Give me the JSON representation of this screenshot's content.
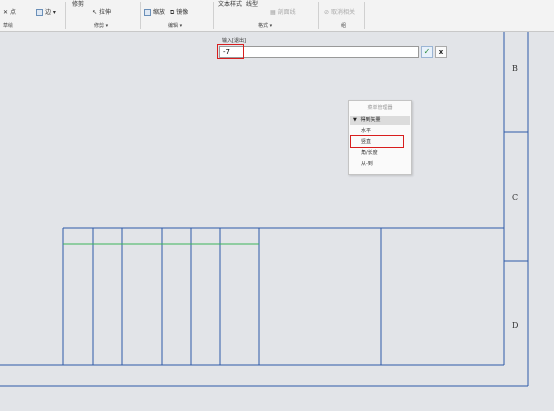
{
  "ribbon": {
    "row1": {
      "trim": "修剪",
      "text_style": "文本样式",
      "line_type": "线型"
    },
    "row2": {
      "point": "点",
      "edge": "边",
      "stretch": "拉伸",
      "scale": "缩放",
      "mirror": "镜像",
      "cross_hatch": "剖面线",
      "cancel_related": "取消相关"
    },
    "groups": {
      "sketch": "草绘",
      "trim": "修剪",
      "edit": "编辑",
      "format": "格式",
      "arrange": "组"
    }
  },
  "input": {
    "label": "输入[退出]",
    "value": "-7",
    "ok_glyph": "✓",
    "cancel_glyph": "x"
  },
  "menu": {
    "title": "菜单管理器",
    "section": "得到矢量",
    "items": [
      "水平",
      "竖直",
      "角/长度",
      "从-到"
    ]
  },
  "zones": [
    "B",
    "C",
    "D"
  ],
  "colors": {
    "drawing_lines": "#2e5aa8",
    "green_line": "#3cb45a",
    "highlight": "#d81e1e"
  }
}
